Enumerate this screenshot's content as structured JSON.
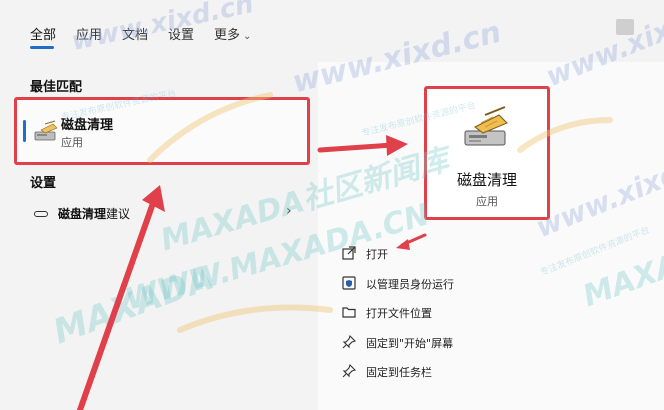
{
  "tabs": [
    {
      "label": "全部",
      "active": true
    },
    {
      "label": "应用",
      "active": false
    },
    {
      "label": "文档",
      "active": false
    },
    {
      "label": "设置",
      "active": false
    },
    {
      "label": "更多",
      "active": false
    }
  ],
  "best_match": {
    "heading": "最佳匹配",
    "title": "磁盘清理",
    "subtitle": "应用",
    "icon": "disk-cleanup-icon"
  },
  "settings": {
    "heading": "设置",
    "item_bold": "磁盘清理",
    "item_rest": "建议",
    "icon": "toggle-icon"
  },
  "detail": {
    "title": "磁盘清理",
    "subtitle": "应用"
  },
  "actions": [
    {
      "label": "打开",
      "icon": "open-icon"
    },
    {
      "label": "以管理员身份运行",
      "icon": "admin-shield-icon"
    },
    {
      "label": "打开文件位置",
      "icon": "folder-icon"
    },
    {
      "label": "固定到\"开始\"屏幕",
      "icon": "pin-icon"
    },
    {
      "label": "固定到任务栏",
      "icon": "pin-icon"
    }
  ],
  "watermarks": {
    "site1": "www.xixd.cn",
    "site2": "MAXADA社区新闻库",
    "site3": "WWW.MAXADA.CN",
    "site4": "MAXADA",
    "small": "专注发布原创软件资源的平台"
  },
  "colors": {
    "accent": "#1f6fc8",
    "highlight": "#e0404a"
  }
}
